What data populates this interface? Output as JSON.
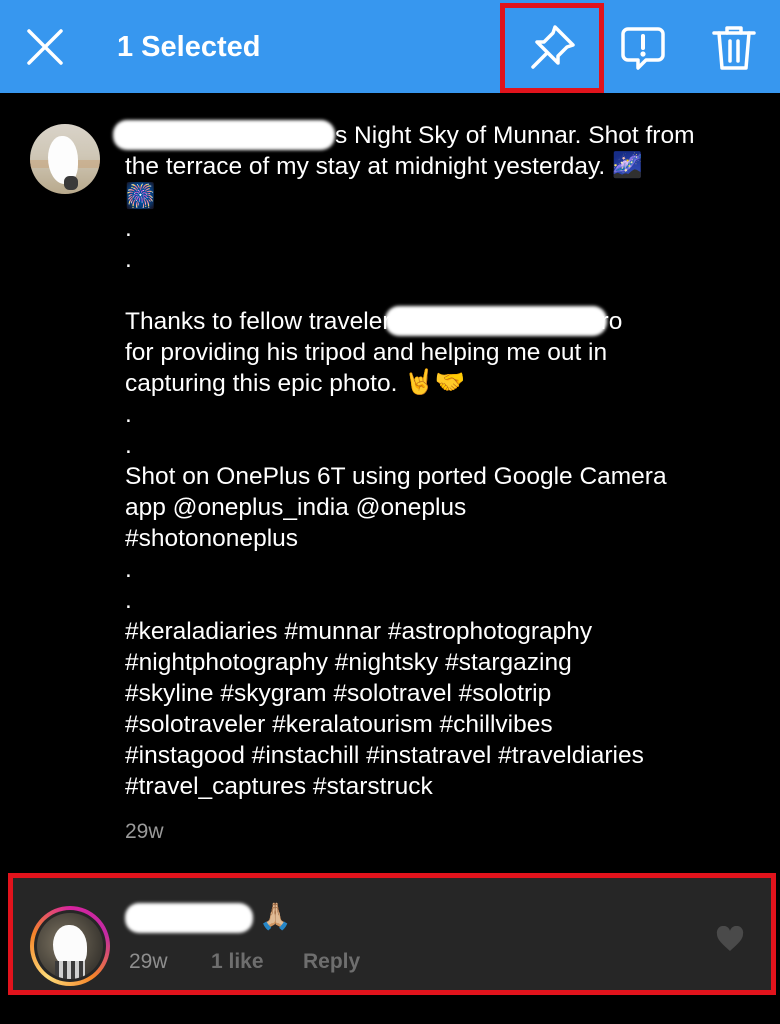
{
  "topbar": {
    "title": "1 Selected",
    "close_icon": "close-icon",
    "pin_icon": "pin-icon",
    "report_icon": "report-icon",
    "delete_icon": "trash-icon",
    "background": "#3797ef",
    "highlight": "#e1131c"
  },
  "caption": {
    "lines": [
      "s Night Sky of Munnar. Shot from",
      "the terrace of my stay at midnight yesterday. ",
      "🎆",
      ".",
      ".",
      "",
      "Thanks to fellow traveler",
      "ro",
      "for providing his tripod and helping me out in",
      "capturing this epic photo. ",
      "🤘🤝",
      ".",
      ".",
      "Shot on OnePlus 6T using ported Google Camera",
      "app @oneplus_india @oneplus",
      "#shotononeplus",
      ".",
      ".",
      "#keraladiaries #munnar #astrophotography",
      "#nightphotography #nightsky #stargazing",
      "#skyline #skygram #solotravel #solotrip",
      "#solotraveler #keralatourism #chillvibes",
      "#instagood #instachill #instatravel #traveldiaries",
      "#travel_captures #starstruck"
    ],
    "emoji_milky_way": "🌌",
    "timestamp": "29w"
  },
  "comment": {
    "text": "🙏🏼",
    "time": "29w",
    "likes": "1 like",
    "reply": "Reply",
    "background": "#262626"
  }
}
